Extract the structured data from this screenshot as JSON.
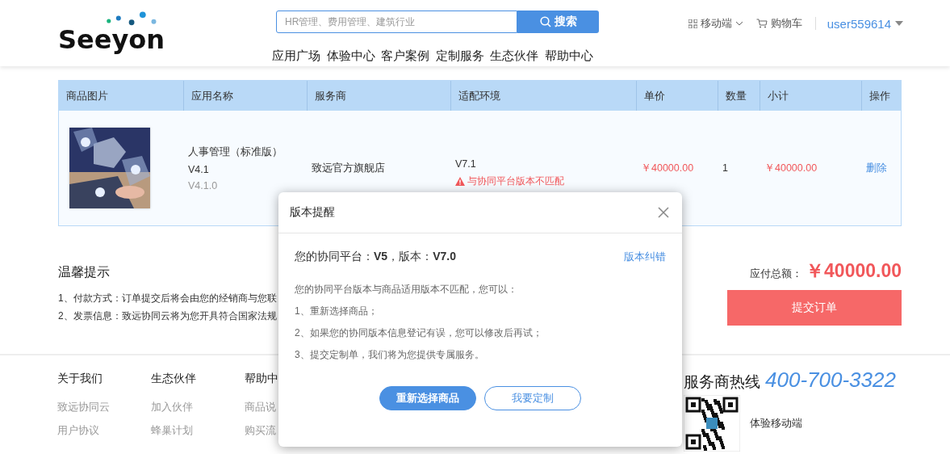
{
  "header": {
    "logo": "Seeyon",
    "search": {
      "placeholder": "HR管理、费用管理、建筑行业",
      "button": "搜索"
    },
    "links": [
      {
        "label": "移动端",
        "kind": "mobile"
      },
      {
        "label": "购物车",
        "kind": "cart"
      }
    ],
    "user": "user559614",
    "nav": [
      "应用广场",
      "体验中心",
      "客户案例",
      "定制服务",
      "生态伙伴",
      "帮助中心"
    ]
  },
  "table": {
    "columns": [
      "商品图片",
      "应用名称",
      "服务商",
      "适配环境",
      "单价",
      "数量",
      "小计",
      "操作"
    ],
    "rows": [
      {
        "name": "人事管理（标准版）",
        "version": "V4.1",
        "sub_version": "V4.1.0",
        "vendor": "致远官方旗舰店",
        "environment": "V7.1",
        "warning": "与协同平台版本不匹配",
        "price": "￥40000.00",
        "quantity": "1",
        "subtotal": "￥40000.00",
        "action": "删除"
      }
    ]
  },
  "tips": {
    "title": "温馨提示",
    "lines": [
      "1、付款方式：订单提交后将会由您的经销商与您联",
      "2、发票信息：致远协同云将为您开具符合国家法规"
    ]
  },
  "total": {
    "label": "应付总额：",
    "amount": "￥40000.00",
    "submit": "提交订单"
  },
  "footer": {
    "columns": [
      {
        "title": "关于我们",
        "links": [
          "致远协同云",
          "用户协议"
        ]
      },
      {
        "title": "生态伙伴",
        "links": [
          "加入伙伴",
          "蜂巢计划"
        ]
      },
      {
        "title": "帮助中",
        "links": [
          "商品说",
          "购买流"
        ]
      }
    ],
    "hotline_label": "服务商热线",
    "hotline": "400-700-3322",
    "mobile": "体验移动端"
  },
  "dialog": {
    "title": "版本提醒",
    "platform": "您的协同平台：**V5**，版本：**V7.0**",
    "correct_link": "版本纠错",
    "message": "您的协同平台版本与商品适用版本不匹配，您可以：",
    "options": [
      "1、重新选择商品；",
      "2、如果您的协同版本信息登记有误，您可以修改后再试；",
      "3、提交定制单，我们将为您提供专属服务。"
    ],
    "buttons": [
      {
        "label": "重新选择商品",
        "kind": "primary"
      },
      {
        "label": "我要定制",
        "kind": "outline"
      }
    ]
  }
}
